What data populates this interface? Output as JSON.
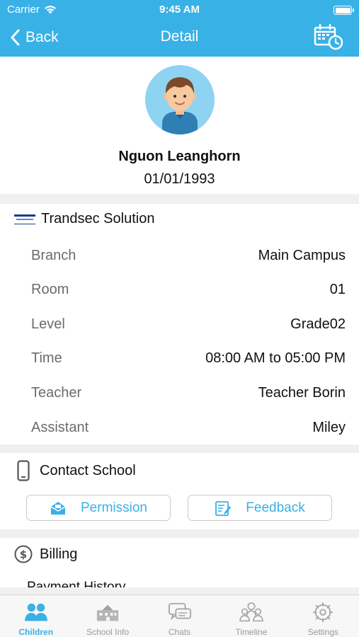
{
  "status_bar": {
    "carrier": "Carrier",
    "time": "9:45 AM"
  },
  "nav": {
    "back_label": "Back",
    "title": "Detail",
    "calendar_icon": "calendar-clock-icon"
  },
  "profile": {
    "name": "Nguon Leanghorn",
    "dob": "01/01/1993",
    "avatar_icon": "boy-avatar-icon"
  },
  "school": {
    "name": "Trandsec Solution",
    "details": [
      {
        "label": "Branch",
        "value": "Main Campus"
      },
      {
        "label": "Room",
        "value": "01"
      },
      {
        "label": "Level",
        "value": "Grade02"
      },
      {
        "label": "Time",
        "value": "08:00 AM to 05:00 PM"
      },
      {
        "label": "Teacher",
        "value": "Teacher Borin"
      },
      {
        "label": "Assistant",
        "value": "Miley"
      }
    ]
  },
  "contact": {
    "title": "Contact School",
    "permission_label": "Permission",
    "feedback_label": "Feedback"
  },
  "billing": {
    "title": "Billing",
    "payment_history": "Payment History"
  },
  "tabbar": [
    {
      "label": "Children",
      "active": true
    },
    {
      "label": "School Info",
      "active": false
    },
    {
      "label": "Chats",
      "active": false
    },
    {
      "label": "Timeline",
      "active": false
    },
    {
      "label": "Settings",
      "active": false
    }
  ],
  "colors": {
    "accent": "#38b1e6",
    "avatar_bg": "#8fd3f3",
    "muted_text": "#6b6b6b"
  }
}
